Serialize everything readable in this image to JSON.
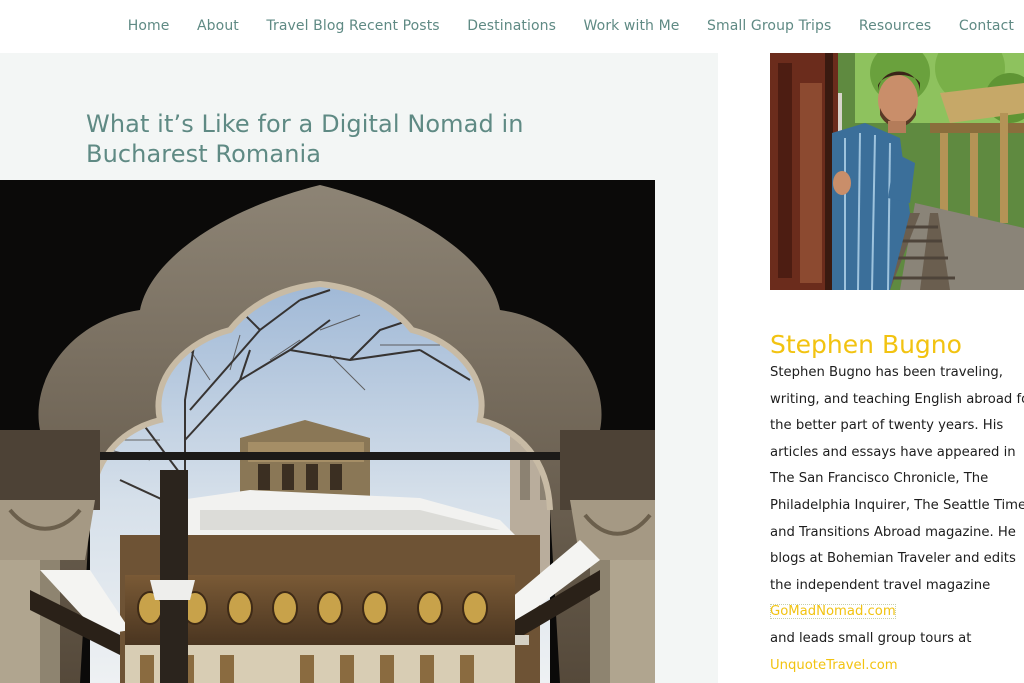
{
  "nav": {
    "items": [
      {
        "label": "Home"
      },
      {
        "label": "About"
      },
      {
        "label": "Travel Blog Recent Posts"
      },
      {
        "label": "Destinations"
      },
      {
        "label": "Work with Me"
      },
      {
        "label": "Small Group Trips"
      },
      {
        "label": "Resources"
      },
      {
        "label": "Contact"
      }
    ]
  },
  "post": {
    "title_line1": "What it’s Like for a Digital Nomad in",
    "title_line2": "Bucharest Romania"
  },
  "sidebar": {
    "author_name": "Stephen Bugno",
    "bio_lines": [
      "Stephen Bugno has been traveling,",
      "writing, and teaching English abroad for",
      "the better part of twenty years. His",
      "articles and essays have appeared in",
      "The San Francisco Chronicle, The",
      "Philadelphia Inquirer, The Seattle Times,",
      "and Transitions Abroad magazine. He",
      "blogs at Bohemian Traveler and edits",
      "the independent travel magazine"
    ],
    "link1": "GoMadNomad.com",
    "bio_after_link": "and leads small group tours at",
    "link2": "UnquoteTravel.com"
  },
  "colors": {
    "accent_nav": "#5f8a84",
    "accent_gold": "#f2c311",
    "panel_bg": "#f3f6f5"
  }
}
